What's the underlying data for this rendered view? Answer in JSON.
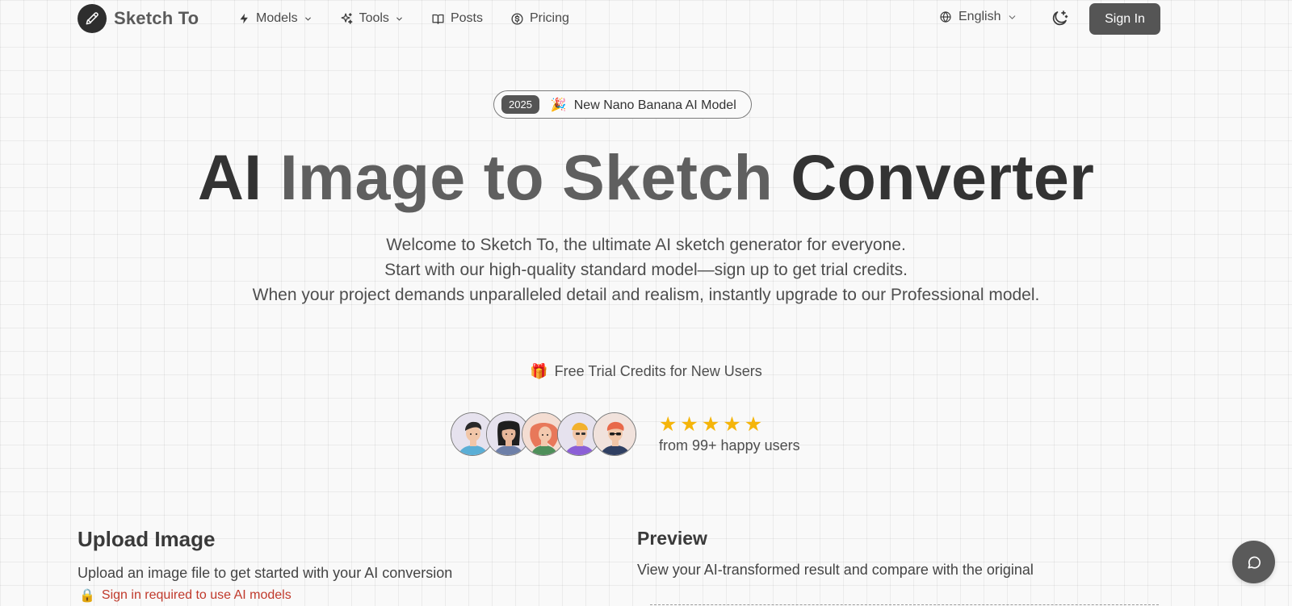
{
  "nav": {
    "brand": "Sketch To",
    "items": [
      {
        "label": "Models",
        "icon": "bolt-icon",
        "has_dropdown": true
      },
      {
        "label": "Tools",
        "icon": "sparkles-icon",
        "has_dropdown": true
      },
      {
        "label": "Posts",
        "icon": "book-icon",
        "has_dropdown": false
      },
      {
        "label": "Pricing",
        "icon": "dollar-circle-icon",
        "has_dropdown": false
      }
    ],
    "language": "English",
    "sign_in": "Sign In"
  },
  "hero": {
    "badge_year": "2025",
    "badge_emoji": "🎉",
    "badge_text": "New Nano Banana AI Model",
    "headline": {
      "part1": "AI",
      "part2": "Image to Sketch",
      "part3": "Converter"
    },
    "subtitle_lines": [
      "Welcome to Sketch To, the ultimate AI sketch generator for everyone.",
      "Start with our high-quality standard model—sign up to get trial credits.",
      "When your project demands unparalleled detail and realism, instantly upgrade to our Professional model."
    ],
    "trial_icon": "🎁",
    "trial_text": "Free Trial Credits for New Users",
    "stars": 5,
    "happy_users": "from 99+ happy users"
  },
  "upload": {
    "title": "Upload Image",
    "description": "Upload an image file to get started with your AI conversion",
    "lock_icon": "🔒",
    "warning": "Sign in required to use AI models"
  },
  "preview": {
    "title": "Preview",
    "description": "View your AI-transformed result and compare with the original"
  },
  "colors": {
    "accent": "#555555",
    "star": "#f5b50a",
    "warning": "#c0392b",
    "background": "#f9f9f9"
  }
}
